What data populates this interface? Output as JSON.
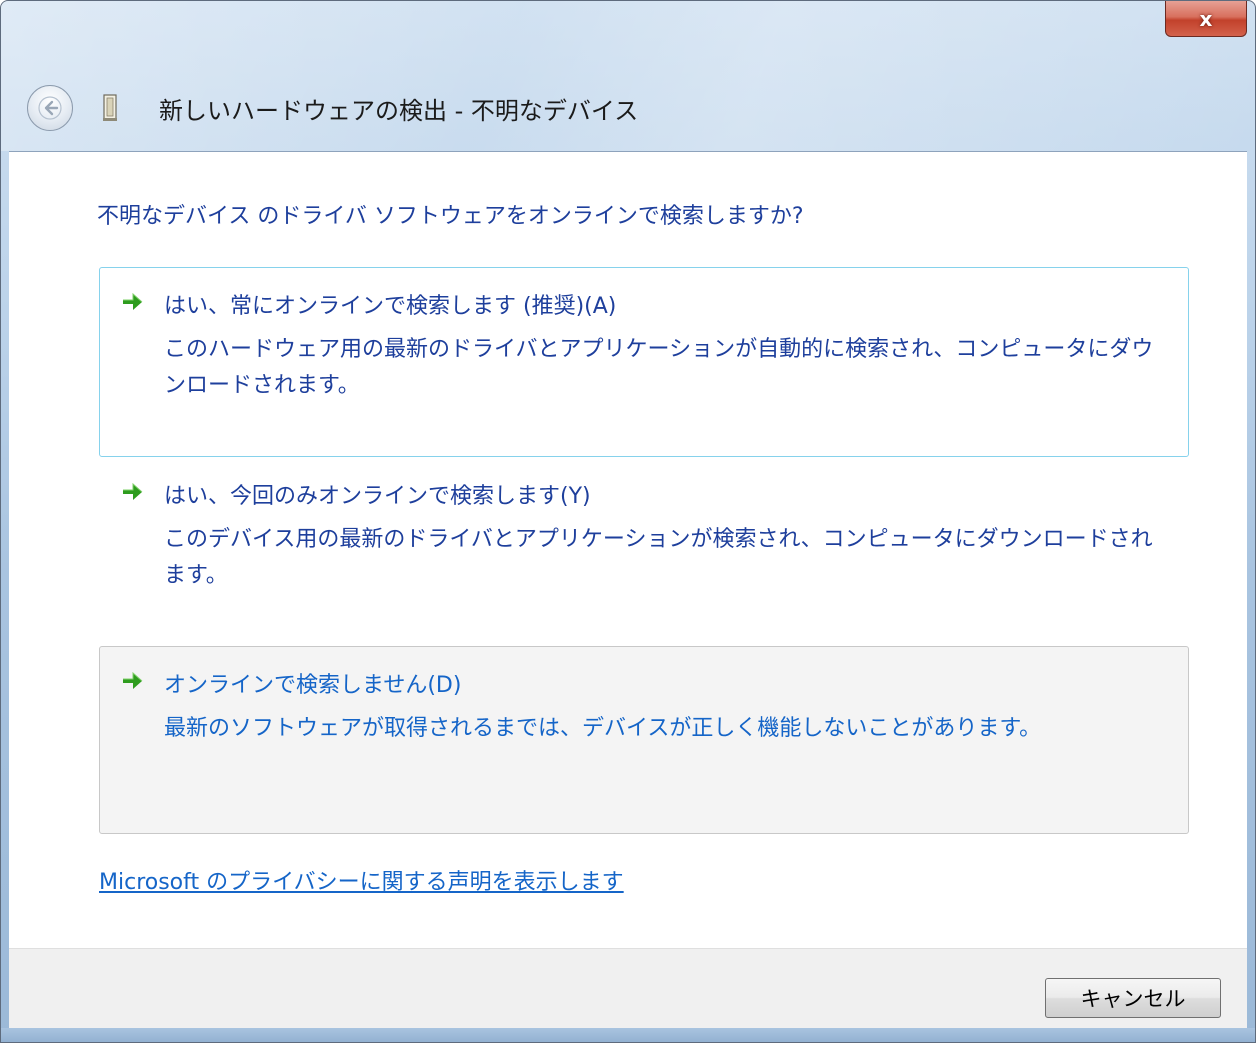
{
  "window": {
    "close_glyph": "x"
  },
  "header": {
    "title": "新しいハードウェアの検出 - 不明なデバイス"
  },
  "question": "不明なデバイス のドライバ ソフトウェアをオンラインで検索しますか?",
  "options": [
    {
      "title": "はい、常にオンラインで検索します (推奨)(A)",
      "description": "このハードウェア用の最新のドライバとアプリケーションが自動的に検索され、コンピュータにダウンロードされます。",
      "state": "focused"
    },
    {
      "title": "はい、今回のみオンラインで検索します(Y)",
      "description": "このデバイス用の最新のドライバとアプリケーションが検索され、コンピュータにダウンロードされます。",
      "state": "normal"
    },
    {
      "title": "オンラインで検索しません(D)",
      "description": "最新のソフトウェアが取得されるまでは、デバイスが正しく機能しないことがあります。",
      "state": "hovered"
    }
  ],
  "privacy_link": "Microsoft のプライバシーに関する声明を表示します",
  "footer": {
    "cancel_label": "キャンセル"
  },
  "colors": {
    "link_text": "#1e3f9c",
    "hover_text": "#1565c8",
    "arrow_green": "#2e9c1e",
    "focus_border": "#86d2ec"
  },
  "icons": {
    "back": "back-arrow-icon",
    "device": "unknown-device-icon",
    "option_arrow": "green-arrow-icon"
  }
}
